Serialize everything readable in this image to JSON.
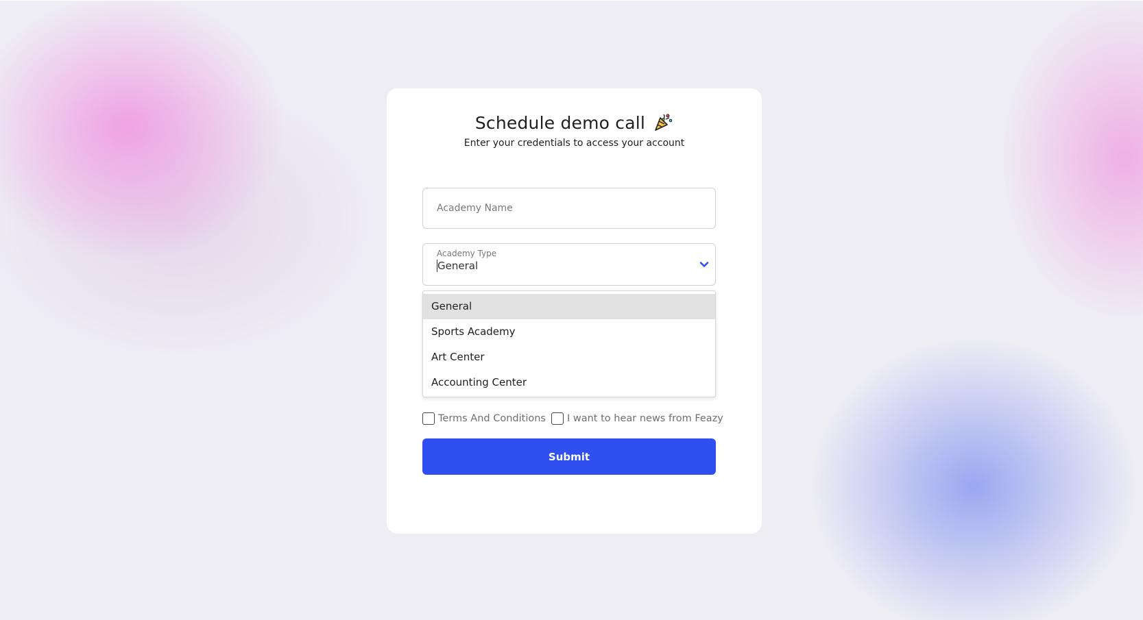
{
  "header": {
    "title": "Schedule demo call",
    "subtitle": "Enter your credentials to access your account"
  },
  "form": {
    "academy_name": {
      "placeholder": "Academy Name",
      "value": ""
    },
    "academy_type": {
      "label": "Academy Type",
      "value": "General",
      "options": [
        "General",
        "Sports Academy",
        "Art Center",
        "Accounting Center"
      ],
      "selected_index": 0
    },
    "terms_label": "Terms And Conditions",
    "news_label": "I want to hear news from Feazy",
    "submit_label": "Submit"
  },
  "colors": {
    "accent": "#2f4ff0",
    "selected_option_bg": "#e1e1e1",
    "card_bg": "#ffffff"
  },
  "icons": {
    "title_icon": "party-popper-icon",
    "dropdown_icon": "chevron-down-icon"
  }
}
